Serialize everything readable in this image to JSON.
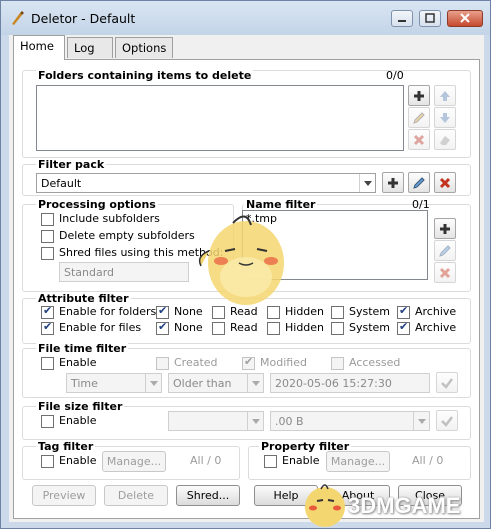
{
  "window": {
    "title": "Deletor - Default"
  },
  "tabs": [
    {
      "label": "Home"
    },
    {
      "label": "Log"
    },
    {
      "label": "Options"
    }
  ],
  "folders": {
    "title": "Folders containing items to delete",
    "count": "0/0"
  },
  "filter_pack": {
    "title": "Filter pack",
    "selected": "Default"
  },
  "processing": {
    "title": "Processing options",
    "include_subfolders": "Include subfolders",
    "delete_empty": "Delete empty subfolders",
    "shred": "Shred files using this method:",
    "method": "Standard"
  },
  "name_filter": {
    "title": "Name filter",
    "count": "0/1",
    "items": [
      "*.tmp"
    ]
  },
  "attribute_filter": {
    "title": "Attribute filter",
    "folders_label": "Enable for folders",
    "files_label": "Enable for files",
    "attrs": [
      "None",
      "Read",
      "Hidden",
      "System",
      "Archive"
    ]
  },
  "file_time_filter": {
    "title": "File time filter",
    "enable": "Enable",
    "created": "Created",
    "modified": "Modified",
    "accessed": "Accessed",
    "unit": "Time",
    "relation": "Older than",
    "datetime": "2020-05-06 15:27:30"
  },
  "file_size_filter": {
    "title": "File size filter",
    "enable": "Enable",
    "size": ".00 B"
  },
  "tag_filter": {
    "title": "Tag filter",
    "enable": "Enable",
    "manage": "Manage...",
    "count": "All / 0"
  },
  "property_filter": {
    "title": "Property filter",
    "enable": "Enable",
    "manage": "Manage...",
    "count": "All / 0"
  },
  "buttons": {
    "preview": "Preview",
    "delete": "Delete",
    "shred": "Shred...",
    "help": "Help",
    "about": "About",
    "close": "Close"
  },
  "watermark": "3DMGAME",
  "colors": {
    "window_frame": "#cbd9ea",
    "accent_check": "#1f3f82",
    "close_button": "#c54a2e"
  }
}
